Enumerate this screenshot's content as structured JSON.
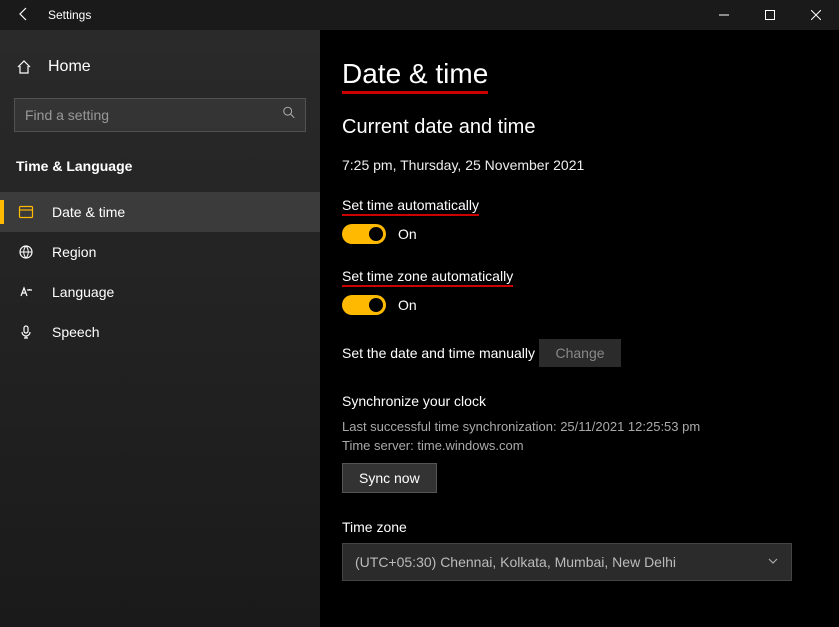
{
  "window": {
    "title": "Settings"
  },
  "sidebar": {
    "home": "Home",
    "search_placeholder": "Find a setting",
    "section": "Time & Language",
    "items": [
      {
        "label": "Date & time"
      },
      {
        "label": "Region"
      },
      {
        "label": "Language"
      },
      {
        "label": "Speech"
      }
    ]
  },
  "main": {
    "title": "Date & time",
    "current_heading": "Current date and time",
    "current_value": "7:25 pm, Thursday, 25 November 2021",
    "auto_time_label": "Set time automatically",
    "auto_time_state": "On",
    "auto_tz_label": "Set time zone automatically",
    "auto_tz_state": "On",
    "manual_label": "Set the date and time manually",
    "change_btn": "Change",
    "sync_heading": "Synchronize your clock",
    "sync_last": "Last successful time synchronization: 25/11/2021 12:25:53 pm",
    "sync_server": "Time server: time.windows.com",
    "sync_btn": "Sync now",
    "tz_label": "Time zone",
    "tz_selected": "(UTC+05:30) Chennai, Kolkata, Mumbai, New Delhi"
  }
}
